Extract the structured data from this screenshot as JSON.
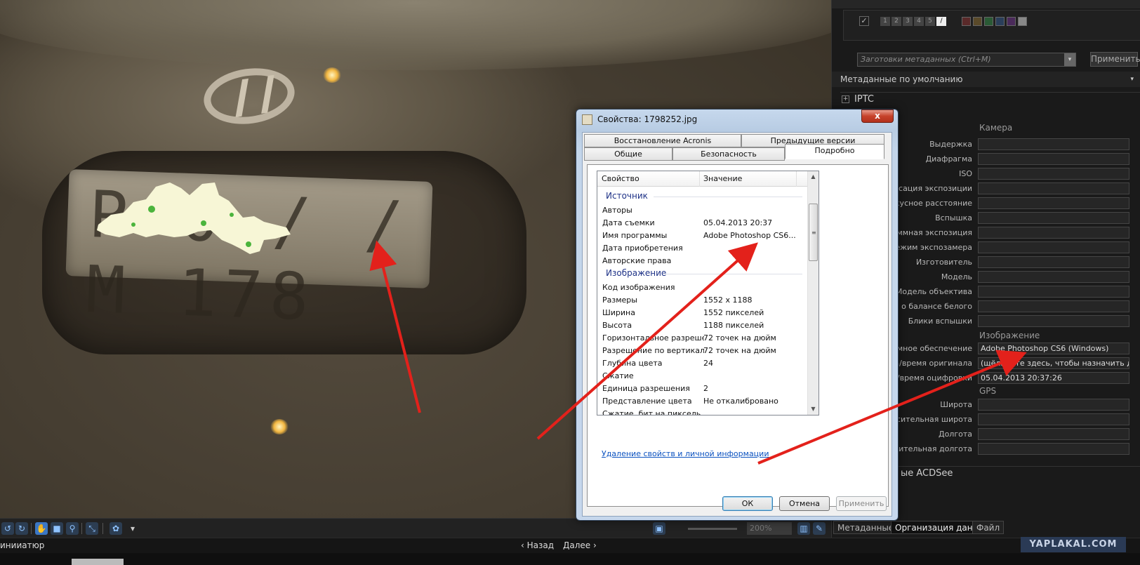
{
  "viewer": {
    "plate_text": "Р 0 / / М 178",
    "zoom_value": "200%",
    "status_left": "инииатюр",
    "nav_back": "‹ Назад",
    "nav_next": "Далее ›"
  },
  "panel": {
    "preset_placeholder": "Заготовки метаданных (Ctrl+M)",
    "apply_label": "Применить",
    "default_metadata": "Метаданные по умолчанию",
    "iptc_label": "IPTC",
    "camera_section": "Камера",
    "image_section": "Изображение",
    "gps_section": "GPS",
    "camera_fields": [
      {
        "label": "Выдержка",
        "value": ""
      },
      {
        "label": "Диафрагма",
        "value": ""
      },
      {
        "label": "ISO",
        "value": ""
      },
      {
        "label": "енсация экспозиции",
        "value": ""
      },
      {
        "label": "окусное расстояние",
        "value": ""
      },
      {
        "label": "Вспышка",
        "value": ""
      },
      {
        "label": "аммная экспозиция",
        "value": ""
      },
      {
        "label": "Режим экспозамера",
        "value": ""
      },
      {
        "label": "Изготовитель",
        "value": ""
      },
      {
        "label": "Модель",
        "value": ""
      },
      {
        "label": "Модель объектива",
        "value": ""
      },
      {
        "label": "ия о балансе белого",
        "value": ""
      },
      {
        "label": "Блики вспышки",
        "value": ""
      }
    ],
    "image_fields": [
      {
        "label": "аммное обеспечение",
        "value": "Adobe Photoshop CS6 (Windows)"
      },
      {
        "label": "та/время оригинала",
        "value": "(щёлкните здесь, чтобы назначить дату)"
      },
      {
        "label": "а/время оцифровки",
        "value": "05.04.2013 20:37:26"
      }
    ],
    "gps_fields": [
      {
        "label": "Широта",
        "value": ""
      },
      {
        "label": "носительная широта",
        "value": ""
      },
      {
        "label": "Долгота",
        "value": ""
      },
      {
        "label": "осительная долгота",
        "value": ""
      }
    ],
    "acdsee_label": "ые ACDSee",
    "tabs": [
      "Метаданные",
      "Организация данных",
      "Файл"
    ],
    "watermark": "YAPLAKAL.COM"
  },
  "dialog": {
    "title": "Свойства: 1798252.jpg",
    "close_label": "x",
    "tabs_top": [
      "Восстановление Acronis",
      "Предыдущие версии"
    ],
    "tabs_bottom": [
      "Общие",
      "Безопасность",
      "Подробно"
    ],
    "col_property": "Свойство",
    "col_value": "Значение",
    "group_source": "Источник",
    "source_rows": [
      {
        "name": "Авторы",
        "value": ""
      },
      {
        "name": "Дата съемки",
        "value": "05.04.2013 20:37"
      },
      {
        "name": "Имя программы",
        "value": "Adobe Photoshop CS6..."
      },
      {
        "name": "Дата приобретения",
        "value": ""
      },
      {
        "name": "Авторские права",
        "value": ""
      }
    ],
    "group_image": "Изображение",
    "image_rows": [
      {
        "name": "Код изображения",
        "value": ""
      },
      {
        "name": "Размеры",
        "value": "1552 x 1188"
      },
      {
        "name": "Ширина",
        "value": "1552 пикселей"
      },
      {
        "name": "Высота",
        "value": "1188 пикселей"
      },
      {
        "name": "Горизонтальное разреше...",
        "value": "72 точек на дюйм"
      },
      {
        "name": "Разрешение по вертикали",
        "value": "72 точек на дюйм"
      },
      {
        "name": "Глубина цвета",
        "value": "24"
      },
      {
        "name": "Сжатие",
        "value": ""
      },
      {
        "name": "Единица разрешения",
        "value": "2"
      },
      {
        "name": "Представление цвета",
        "value": "Не откалибровано"
      },
      {
        "name": "Сжатие, бит на пиксель",
        "value": ""
      }
    ],
    "remove_link": "Удаление свойств и личной информации",
    "ok_label": "ОК",
    "cancel_label": "Отмена",
    "apply_label": "Применить"
  },
  "colors": {
    "arrow": "#e3211b",
    "panel_bg": "#1a1a1a",
    "dialog_frame": "#c3d5ea",
    "link": "#0b52c0",
    "group_header": "#1e3287"
  }
}
